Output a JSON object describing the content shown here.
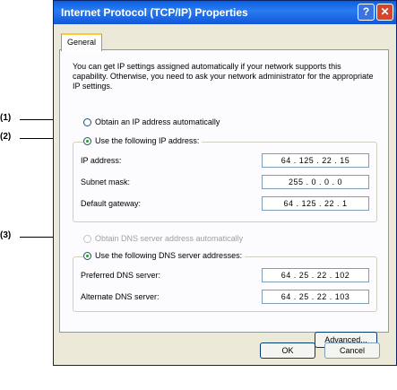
{
  "window": {
    "title": "Internet Protocol (TCP/IP) Properties",
    "help": "?",
    "close": "✕"
  },
  "tab": "General",
  "intro": "You can get IP settings assigned automatically if your network supports this capability. Otherwise, you need to ask your network administrator for the appropriate IP settings.",
  "callouts": [
    "(1)",
    "(2)",
    "(3)"
  ],
  "ip": {
    "auto_label": "Obtain an IP address automatically",
    "manual_label": "Use the following IP address:",
    "address_label": "IP address:",
    "address_value": "64 . 125 . 22 . 15",
    "subnet_label": "Subnet mask:",
    "subnet_value": "255 .  0  .  0  .  0",
    "gateway_label": "Default gateway:",
    "gateway_value": "64 . 125 . 22 .  1"
  },
  "dns": {
    "auto_label": "Obtain DNS server address automatically",
    "manual_label": "Use the following DNS server addresses:",
    "preferred_label": "Preferred DNS server:",
    "preferred_value": "64 . 25 . 22 . 102",
    "alternate_label": "Alternate DNS server:",
    "alternate_value": "64 . 25 . 22 . 103"
  },
  "buttons": {
    "advanced": "Advanced...",
    "ok": "OK",
    "cancel": "Cancel"
  }
}
